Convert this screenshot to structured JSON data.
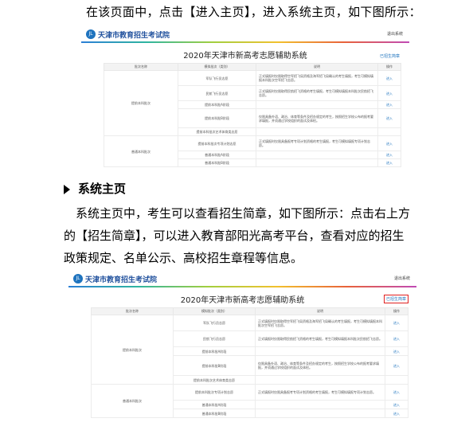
{
  "intro_line": "在该页面中，点击【进入主页】，进入系统主页，如下图所示：",
  "section_heading": "系统主页",
  "section_paragraph": "系统主页中，考生可以查看招生简章，如下图所示：点击右上方的【招生简章】，可以进入教育部阳光高考平台，查看对应的招生政策规定、名单公示、高校招生章程等信息。",
  "screenshot": {
    "site_name": "天津市教育招生考试院",
    "logo_text": "JL",
    "header_link": "退出系统",
    "system_title": "2020年天津市新高考志愿辅助系统",
    "guide_link": "已招生简章",
    "columns": [
      "批次名称",
      "模拟批次（类别）",
      "说明",
      "操作"
    ],
    "batch_groups": [
      {
        "batch": "提前本科批次",
        "rows": [
          {
            "category": "军队飞行员志愿",
            "desc": "正式填报时仅限取得空军招飞局资格及海军招飞局确认的考生填报，考生可模拟填报本科批次空军招飞志愿。",
            "action": "进入"
          },
          {
            "category": "民航飞行员志愿",
            "desc": "正式填报时仅限取得民航招飞资格的考生填报，考生可模拟填报本科批次民航招飞志愿。",
            "action": "进入"
          },
          {
            "category": "提前本科批A阶段",
            "desc": "",
            "action": "进入"
          },
          {
            "category": "提前本科批B阶段",
            "desc": "仅限具备外语、政治、体育等条件及招办规定的考生，按照招生学校公布的报考要求填报，并须通过学校组织的面试及体检。",
            "action": "进入"
          },
          {
            "category": "提前本科批次艺术体育类志愿",
            "desc": "",
            "action": ""
          }
        ]
      },
      {
        "batch": "普通本科批次",
        "rows": [
          {
            "category": "提前本科批次专项计划志愿",
            "desc": "正式填报时仅限具备报考专项计划资格的考生填报，考生可模拟填报专项计划志愿。",
            "action": "进入"
          },
          {
            "category": "普通本科批A阶段",
            "desc": "",
            "action": "进入"
          },
          {
            "category": "普通本科批B阶段",
            "desc": "",
            "action": "进入"
          }
        ]
      }
    ]
  }
}
